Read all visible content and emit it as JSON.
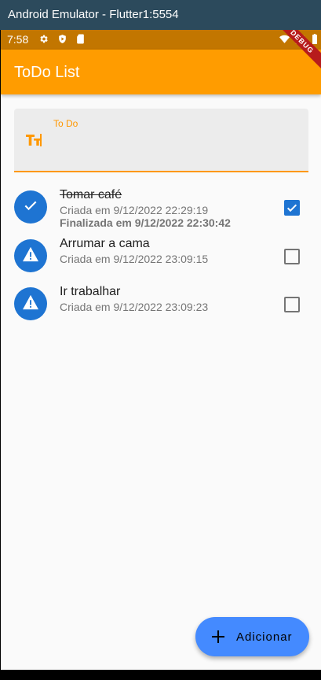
{
  "window": {
    "title": "Android Emulator - Flutter1:5554"
  },
  "status_bar": {
    "time": "7:58",
    "icons": [
      "gear-icon",
      "shield-icon",
      "sd-card-icon",
      "wifi-icon",
      "signal-icon",
      "battery-icon"
    ],
    "debug_banner": "DEBUG"
  },
  "app_bar": {
    "title": "ToDo List",
    "color": "#ff9c00"
  },
  "input": {
    "label": "To Do",
    "value": "",
    "icon": "text-fields-icon",
    "accent": "#ff9800"
  },
  "todos": [
    {
      "title": "Tomar café",
      "created": "Criada em 9/12/2022 22:29:19",
      "finished": "Finalizada em 9/12/2022 22:30:42",
      "done": true,
      "icon": "check-icon"
    },
    {
      "title": "Arrumar a cama",
      "created": "Criada em 9/12/2022 23:09:15",
      "done": false,
      "icon": "warning-icon"
    },
    {
      "title": "Ir trabalhar",
      "created": "Criada em 9/12/2022 23:09:23",
      "done": false,
      "icon": "warning-icon"
    }
  ],
  "fab": {
    "label": "Adicionar",
    "icon": "plus-icon",
    "color": "#448aff"
  }
}
